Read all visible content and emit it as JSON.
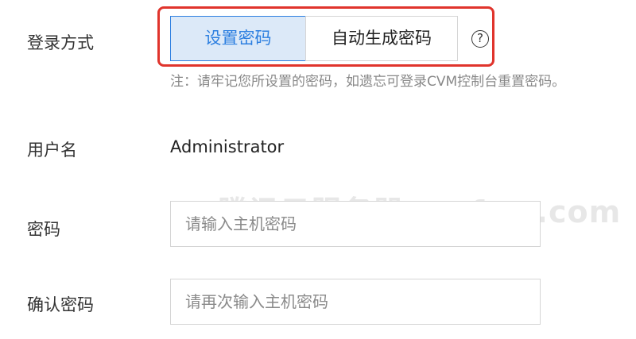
{
  "login_method": {
    "label": "登录方式",
    "options": [
      {
        "label": "设置密码",
        "selected": true
      },
      {
        "label": "自动生成密码",
        "selected": false
      }
    ],
    "help_symbol": "?",
    "note": "注：请牢记您所设置的密码，如遗忘可登录CVM控制台重置密码。"
  },
  "username": {
    "label": "用户名",
    "value": "Administrator"
  },
  "password": {
    "label": "密码",
    "placeholder": "请输入主机密码"
  },
  "confirm_password": {
    "label": "确认密码",
    "placeholder": "请再次输入主机密码"
  },
  "watermark": "腾讯云服务器 txyfwq.com",
  "colors": {
    "accent": "#2d7fe0",
    "selected_bg": "#dce9f8",
    "highlight_border": "#e0342c",
    "note_text": "#888888"
  },
  "icons": {
    "help": "question-circle-icon"
  }
}
